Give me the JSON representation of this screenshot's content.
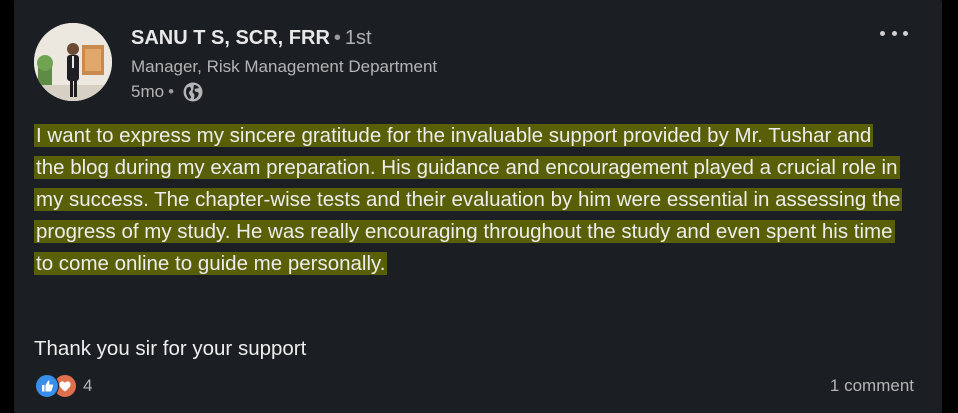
{
  "author": {
    "name": "SANU T S, SCR, FRR",
    "degree_separator": "•",
    "degree": "1st",
    "headline": "Manager, Risk Management Department",
    "time_ago": "5mo",
    "meta_separator": "•",
    "visibility_icon": "globe-icon"
  },
  "menu": {
    "icon": "more-horizontal-icon"
  },
  "post": {
    "highlighted_text": "I want to express my sincere gratitude for the invaluable support provided by Mr. Tushar and the blog during my exam preparation. His guidance and encouragement played a crucial role in my success. The chapter-wise tests and their evaluation by him were essential in assessing the progress of my study. He was really encouraging throughout the study and even spent his time to come online to guide me personally.",
    "closing_text": "Thank you sir for your support",
    "highlight_color": "#595f06"
  },
  "social": {
    "reaction_icons": [
      "like-icon",
      "love-icon"
    ],
    "reaction_count": "4",
    "comments_label": "1 comment"
  },
  "colors": {
    "card_background": "#1b1f23",
    "like": "#378fe9",
    "love": "#df704d"
  }
}
